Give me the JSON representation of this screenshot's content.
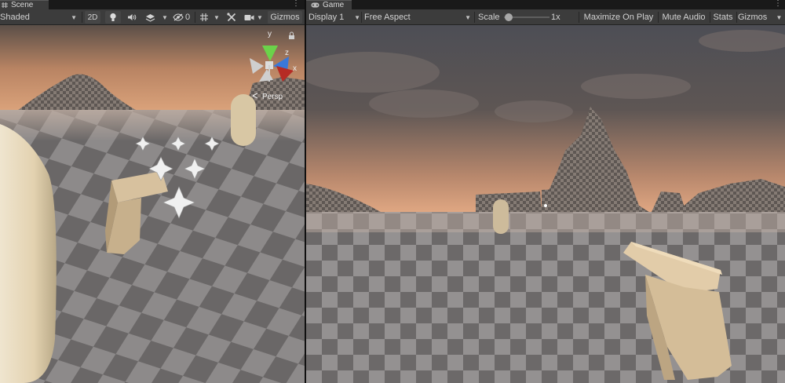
{
  "scene": {
    "tab_label": "Scene",
    "toolbar": {
      "shading_mode": "Shaded",
      "mode_2d_label": "2D",
      "hidden_count": "0",
      "gizmos_label": "Gizmos"
    },
    "orientation_gizmo": {
      "axis_y": "y",
      "axis_z": "z",
      "axis_x": "x",
      "projection_label": "Persp"
    }
  },
  "game": {
    "tab_label": "Game",
    "toolbar": {
      "display_label": "Display 1",
      "aspect_label": "Free Aspect",
      "scale_label": "Scale",
      "scale_value": "1x",
      "scale_slider_fraction": 0.02,
      "maximize_label": "Maximize On Play",
      "mute_label": "Mute Audio",
      "stats_label": "Stats",
      "gizmos_label": "Gizmos"
    }
  },
  "colors": {
    "toolbar_bg": "#3c3c3c",
    "tab_bg": "#191919",
    "axis_x": "#d6342a",
    "axis_y": "#6bd24a",
    "axis_z": "#3a78d8",
    "sky_top": "#4a4f58",
    "sky_horizon": "#d99a6f",
    "ground": "#8a8686"
  },
  "icons": {
    "scene_tab": "grid-hash-icon",
    "game_tab": "gamepad-icon",
    "lighting": "light-bulb-icon",
    "audio": "speaker-icon",
    "effects": "effects-layers-icon",
    "visibility": "eye-slash-icon",
    "tools": "wrench-tools-icon",
    "grid": "grid-snap-icon",
    "camera": "camera-icon",
    "lock": "lock-icon",
    "menu": "kebab-menu-icon"
  }
}
